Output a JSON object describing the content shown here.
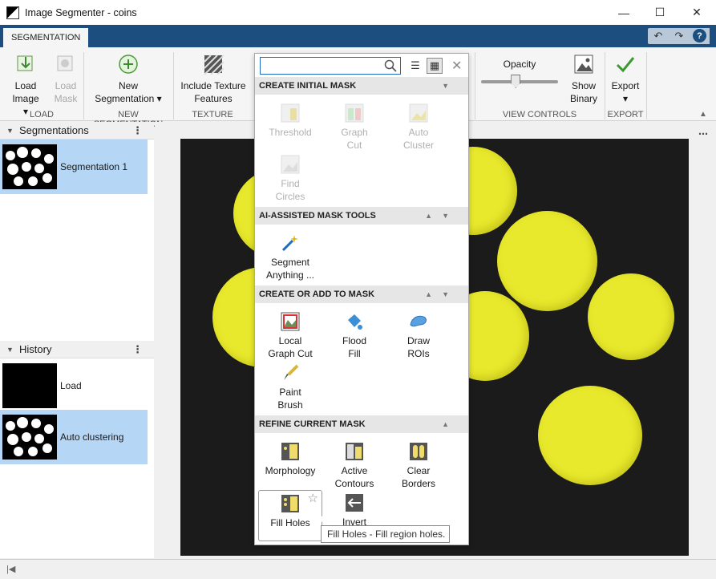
{
  "window": {
    "title": "Image Segmenter - coins"
  },
  "ribbon": {
    "tab": "SEGMENTATION",
    "sections": {
      "load": "LOAD",
      "new_segmentation": "NEW SEGMENTATION",
      "texture": "TEXTURE",
      "view_controls": "VIEW CONTROLS",
      "export": "EXPORT"
    },
    "buttons": {
      "load_image_1": "Load",
      "load_image_2": "Image ▾",
      "load_mask_1": "Load",
      "load_mask_2": "Mask",
      "new_seg_1": "New",
      "new_seg_2": "Segmentation ▾",
      "texture_1": "Include Texture",
      "texture_2": "Features",
      "opacity": "Opacity",
      "show_binary_1": "Show",
      "show_binary_2": "Binary",
      "export_1": "Export",
      "export_2": "▾"
    },
    "opacity_value": 0.45
  },
  "segmentations_panel": {
    "title": "Segmentations",
    "items": [
      {
        "label": "Segmentation 1"
      }
    ]
  },
  "history_panel": {
    "title": "History",
    "items": [
      {
        "label": "Load"
      },
      {
        "label": "Auto clustering"
      }
    ]
  },
  "gallery": {
    "search_placeholder": "",
    "categories": [
      {
        "title": "CREATE INITIAL MASK"
      },
      {
        "title": "AI-ASSISTED MASK TOOLS"
      },
      {
        "title": "CREATE OR ADD TO MASK"
      },
      {
        "title": "REFINE CURRENT MASK"
      }
    ],
    "items": {
      "threshold": "Threshold",
      "graph_cut_1": "Graph",
      "graph_cut_2": "Cut",
      "auto_cluster_1": "Auto",
      "auto_cluster_2": "Cluster",
      "find_circles_1": "Find",
      "find_circles_2": "Circles",
      "segment_anything_1": "Segment",
      "segment_anything_2": "Anything ...",
      "local_graph_cut_1": "Local",
      "local_graph_cut_2": "Graph Cut",
      "flood_fill_1": "Flood",
      "flood_fill_2": "Fill",
      "draw_rois_1": "Draw",
      "draw_rois_2": "ROIs",
      "paint_brush_1": "Paint",
      "paint_brush_2": "Brush",
      "morphology": "Morphology",
      "active_contours_1": "Active",
      "active_contours_2": "Contours",
      "clear_borders_1": "Clear",
      "clear_borders_2": "Borders",
      "fill_holes": "Fill Holes",
      "invert": "Invert"
    }
  },
  "tooltip": "Fill Holes - Fill region holes.",
  "colors": {
    "ribbon_blue": "#1c4e80",
    "selection": "#b5d6f5",
    "coin_overlay": "#e8e82c"
  }
}
